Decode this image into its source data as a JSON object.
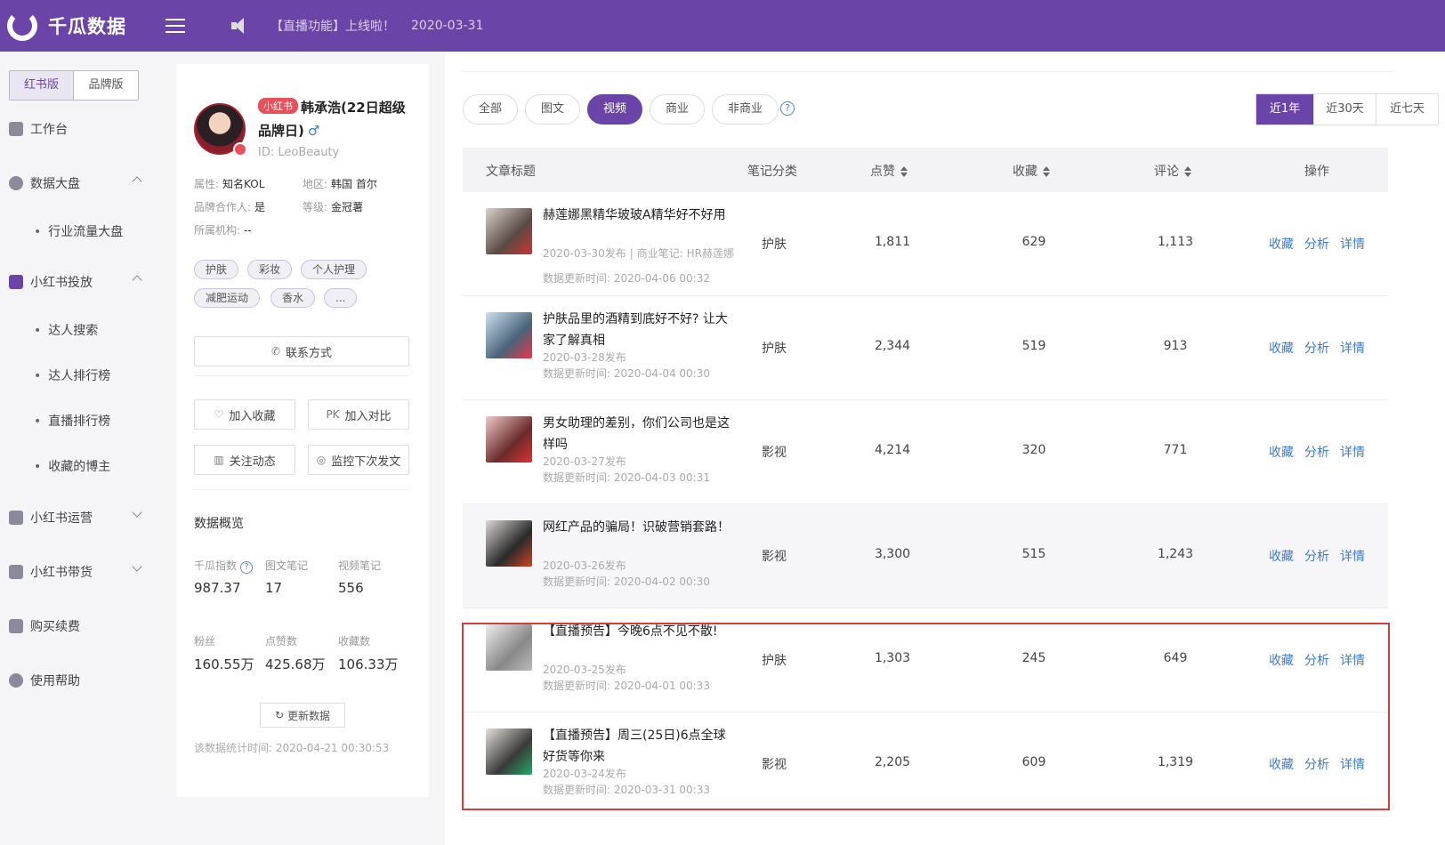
{
  "app": {
    "name": "千瓜数据"
  },
  "topbar": {
    "notice": "【直播功能】上线啦！",
    "notice_date": "2020-03-31"
  },
  "sidebar": {
    "version_tabs": [
      "红书版",
      "品牌版"
    ],
    "items": [
      {
        "label": "工作台"
      },
      {
        "label": "数据大盘",
        "children": [
          "行业流量大盘"
        ]
      },
      {
        "label": "小红书投放",
        "children": [
          "达人搜索",
          "达人排行榜",
          "直播排行榜",
          "收藏的博主"
        ]
      },
      {
        "label": "小红书运营"
      },
      {
        "label": "小红书带货"
      },
      {
        "label": "购买续费"
      },
      {
        "label": "使用帮助"
      }
    ]
  },
  "profile": {
    "platform_tag": "小红书",
    "name": "韩承浩(22日超级品牌日)",
    "gender_icon": "♂",
    "id": "ID:  LeoBeauty",
    "attrs": {
      "type_label": "属性:",
      "type_value": "知名KOL",
      "region_label": "地区:",
      "region_value": "韩国 首尔",
      "brand_label": "品牌合作人:",
      "brand_value": "是",
      "level_label": "等级:",
      "level_value": "金冠薯",
      "org_label": "所属机构:",
      "org_value": "--"
    },
    "tags": [
      "护肤",
      "彩妆",
      "个人护理",
      "减肥运动",
      "香水",
      "..."
    ],
    "contact_button": "联系方式",
    "fav_button": "加入收藏",
    "compare_button": "加入对比",
    "compare_prefix": "PK",
    "follow_button": "关注动态",
    "monitor_button": "监控下次发文",
    "overview_title": "数据概览",
    "stats": {
      "index_label": "千瓜指数",
      "index_value": "987.37",
      "image_notes_label": "图文笔记",
      "image_notes_value": "17",
      "video_notes_label": "视频笔记",
      "video_notes_value": "556",
      "fans_label": "粉丝",
      "fans_value": "160.55万",
      "likes_label": "点赞数",
      "likes_value": "425.68万",
      "collects_label": "收藏数",
      "collects_value": "106.33万"
    },
    "update_button": "更新数据",
    "stat_time": "该数据统计时间: 2020-04-21 00:30:53"
  },
  "filters": [
    "全部",
    "图文",
    "视频",
    "商业",
    "非商业"
  ],
  "active_filter": "视频",
  "ranges": [
    "近1年",
    "近30天",
    "近七天"
  ],
  "active_range": "近1年",
  "table": {
    "headers": {
      "title": "文章标题",
      "category": "笔记分类",
      "likes": "点赞",
      "collects": "收藏",
      "comments": "评论",
      "ops": "操作"
    },
    "op_labels": [
      "收藏",
      "分析",
      "详情"
    ],
    "rows": [
      {
        "title": "赫莲娜黑精华玻玻A精华好不好用",
        "published": "2020-03-30发布",
        "commercial": "商业笔记: HR赫莲娜",
        "updated": "数据更新时间:  2020-04-06 00:32",
        "category": "护肤",
        "likes": "1,811",
        "collects": "629",
        "comments": "1,113"
      },
      {
        "title": "护肤品里的酒精到底好不好? 让大家了解真相",
        "published": "2020-03-28发布",
        "updated": "数据更新时间:  2020-04-04 00:30",
        "category": "护肤",
        "likes": "2,344",
        "collects": "519",
        "comments": "913"
      },
      {
        "title": "男女助理的差别，你们公司也是这样吗",
        "published": "2020-03-27发布",
        "updated": "数据更新时间:  2020-04-03 00:31",
        "category": "影视",
        "likes": "4,214",
        "collects": "320",
        "comments": "771"
      },
      {
        "title": "网红产品的骗局！识破营销套路！",
        "published": "2020-03-26发布",
        "updated": "数据更新时间:  2020-04-02 00:30",
        "category": "影视",
        "likes": "3,300",
        "collects": "515",
        "comments": "1,243"
      },
      {
        "title": "【直播预告】今晚6点不见不散!",
        "published": "2020-03-25发布",
        "updated": "数据更新时间:  2020-04-01 00:33",
        "category": "护肤",
        "likes": "1,303",
        "collects": "245",
        "comments": "649"
      },
      {
        "title": "【直播预告】周三(25日)6点全球好货等你来",
        "published": "2020-03-24发布",
        "updated": "数据更新时间:  2020-03-31 00:33",
        "category": "影视",
        "likes": "2,205",
        "collects": "609",
        "comments": "1,319"
      }
    ]
  },
  "colors": {
    "brand": "#6b44a8",
    "link": "#3a7bd5",
    "highlight": "#d93c3c"
  }
}
